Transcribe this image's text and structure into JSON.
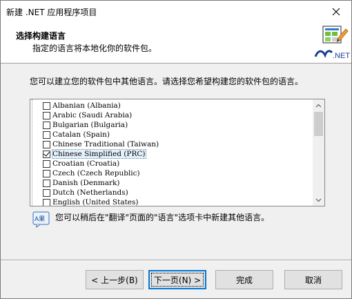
{
  "window": {
    "title": "新建 .NET 应用程序项目"
  },
  "header": {
    "title": "选择构建语言",
    "subtitle": "指定的语言将本地化你的软件包。",
    "logo_text": ".NET",
    "logo_icon": "dotnet-wizard-icon"
  },
  "instructions": "您可以建立您的软件包中其他语言。请选择您希望构建您的软件包的语言。",
  "languages": [
    {
      "label": "Albanian (Albania)",
      "checked": false
    },
    {
      "label": "Arabic (Saudi Arabia)",
      "checked": false
    },
    {
      "label": "Bulgarian (Bulgaria)",
      "checked": false
    },
    {
      "label": "Catalan (Spain)",
      "checked": false
    },
    {
      "label": "Chinese Traditional (Taiwan)",
      "checked": false
    },
    {
      "label": "Chinese Simplified (PRC)",
      "checked": true,
      "selected": true
    },
    {
      "label": "Croatian (Croatia)",
      "checked": false
    },
    {
      "label": "Czech (Czech Republic)",
      "checked": false
    },
    {
      "label": "Danish (Denmark)",
      "checked": false
    },
    {
      "label": "Dutch (Netherlands)",
      "checked": false
    },
    {
      "label": "English (United States)",
      "checked": false
    }
  ],
  "note": {
    "icon": "translate-icon",
    "icon_text": "A果",
    "text": "您可以稍后在\"翻译\"页面的\"语言\"选项卡中新建其他语言。"
  },
  "buttons": {
    "back": "< 上一步(B)",
    "next": "下一页(N) >",
    "finish": "完成",
    "cancel": "取消"
  },
  "colors": {
    "accent": "#0078d7",
    "selection": "#e5f1fb"
  }
}
